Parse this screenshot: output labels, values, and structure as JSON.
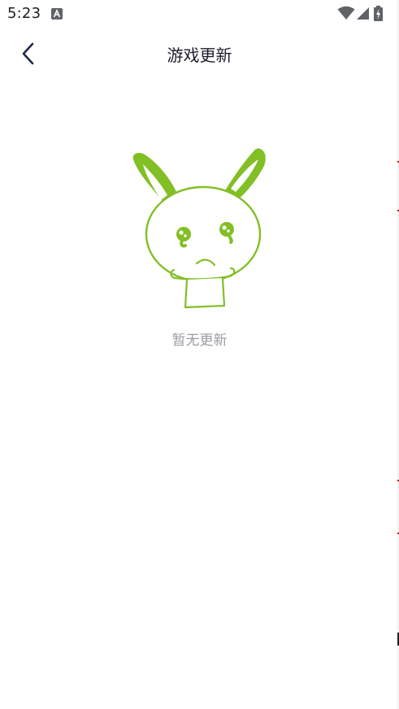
{
  "status_bar": {
    "time": "5:23",
    "notification_icon": "a-box-icon",
    "wifi_icon": "wifi-icon",
    "signal_icon": "signal-icon",
    "battery_icon": "battery-charging-icon"
  },
  "toolbar": {
    "back_icon": "chevron-left-icon",
    "title": "游戏更新"
  },
  "empty_state": {
    "illustration": "bunny-illustration",
    "message": "暂无更新"
  },
  "colors": {
    "accent_green": "#82bf25",
    "title_text": "#1b1b2e",
    "back_icon": "#1f2a4d",
    "muted_text": "#9a9ca3"
  }
}
